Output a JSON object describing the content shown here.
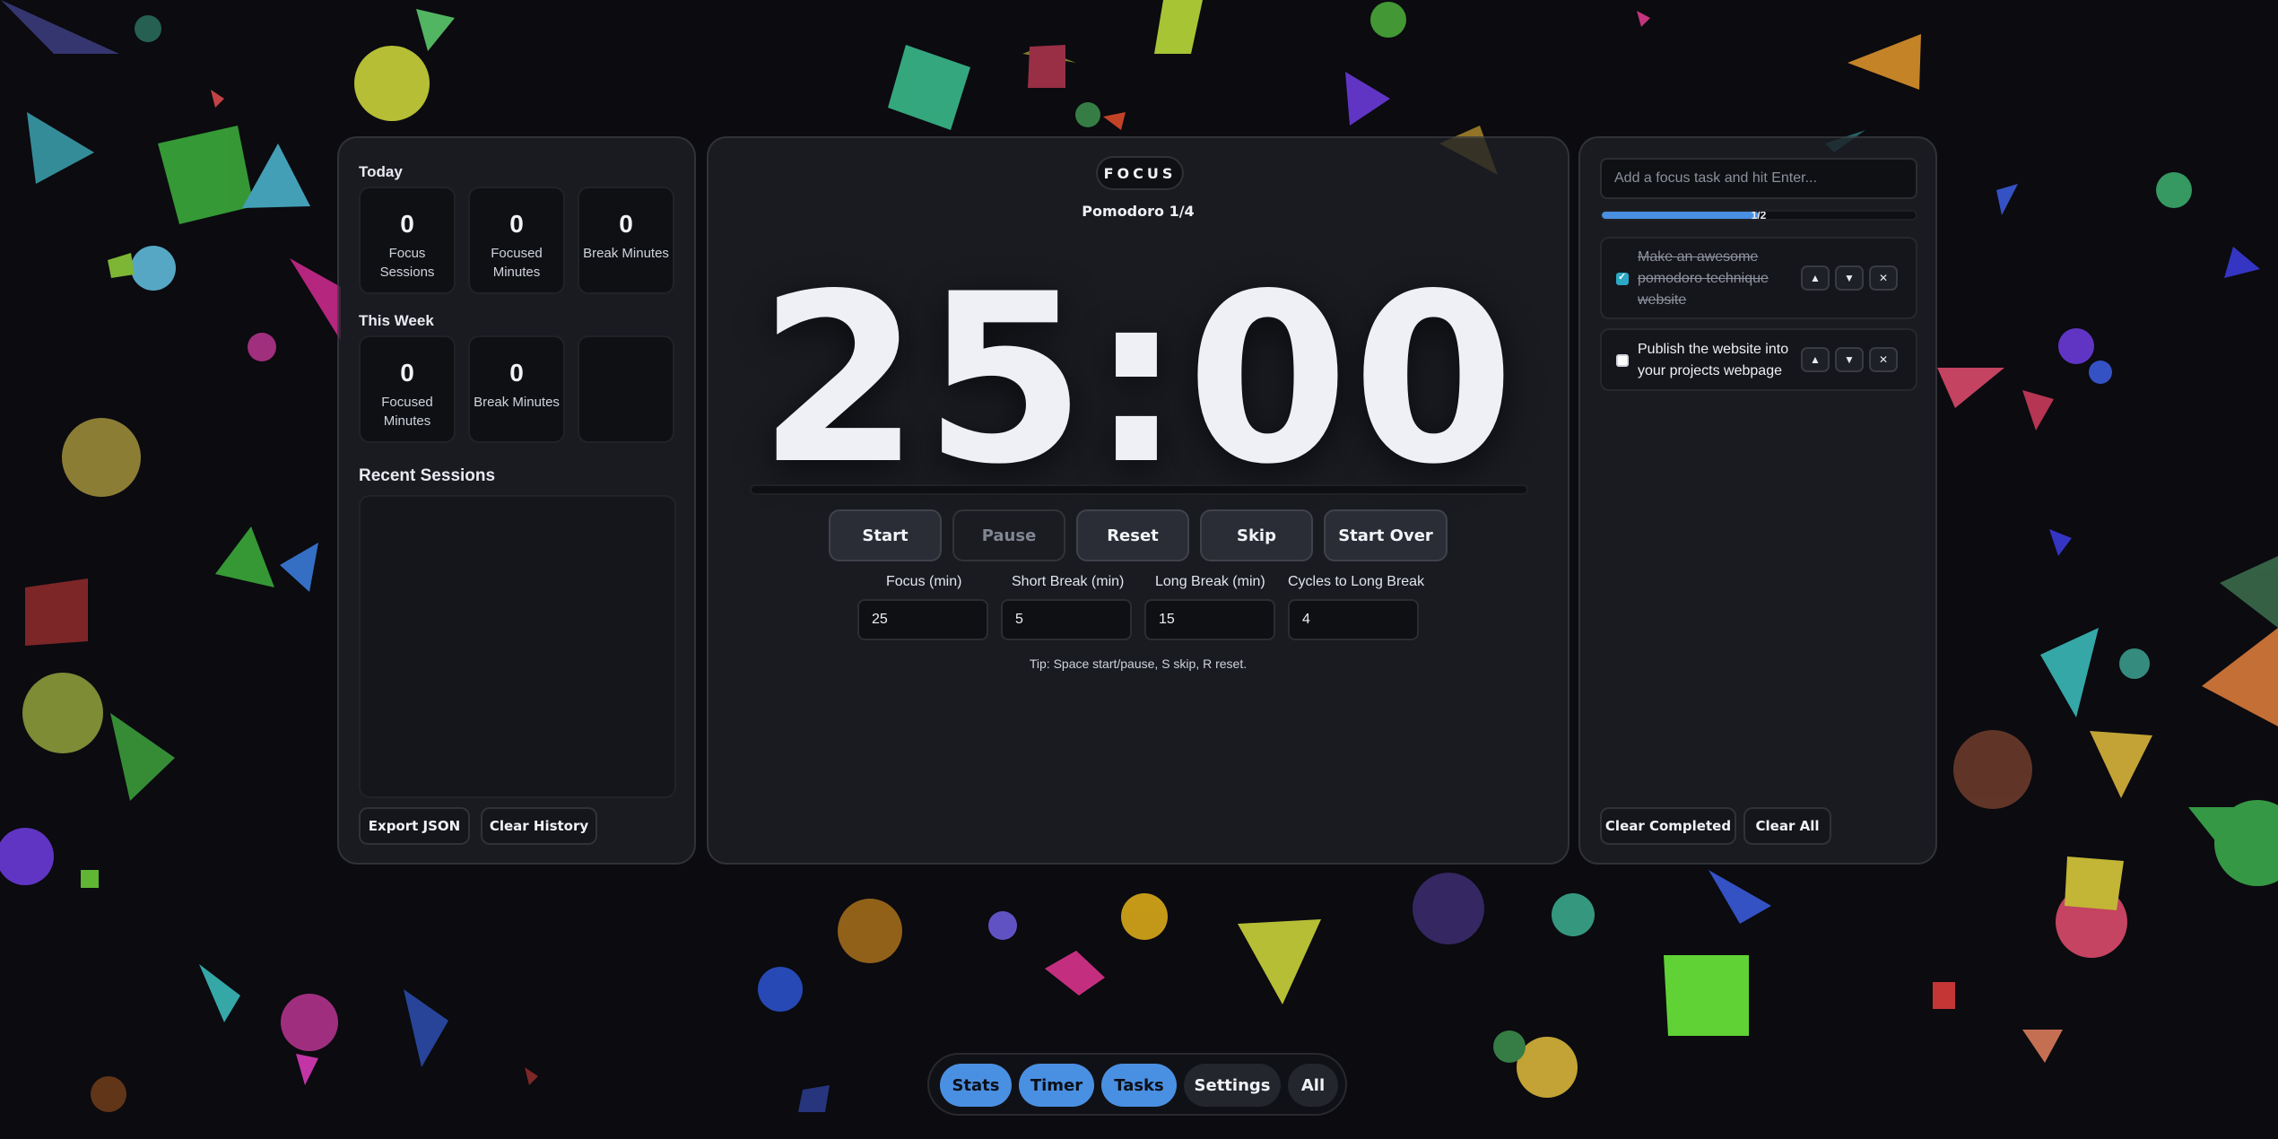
{
  "stats": {
    "today_label": "Today",
    "today": [
      {
        "value": "0",
        "label": "Focus Sessions"
      },
      {
        "value": "0",
        "label": "Focused Minutes"
      },
      {
        "value": "0",
        "label": "Break Minutes"
      }
    ],
    "week_label": "This Week",
    "week": [
      {
        "value": "0",
        "label": "Focused Minutes"
      },
      {
        "value": "0",
        "label": "Break Minutes"
      }
    ],
    "recent_label": "Recent Sessions",
    "export_label": "Export JSON",
    "clear_history_label": "Clear History"
  },
  "timer": {
    "mode": "FOCUS",
    "cycle": "Pomodoro 1/4",
    "time": "25:00",
    "progress": 0,
    "buttons": {
      "start": "Start",
      "pause": "Pause",
      "reset": "Reset",
      "skip": "Skip",
      "start_over": "Start Over"
    },
    "settings": [
      {
        "label": "Focus (min)",
        "value": "25"
      },
      {
        "label": "Short Break (min)",
        "value": "5"
      },
      {
        "label": "Long Break (min)",
        "value": "15"
      },
      {
        "label": "Cycles to Long Break",
        "value": "4"
      }
    ],
    "tip": "Tip: Space start/pause, S skip, R reset."
  },
  "tasks": {
    "input_placeholder": "Add a focus task and hit Enter...",
    "progress_text": "1/2",
    "progress_fraction": 0.5,
    "items": [
      {
        "text": "Make an awesome pomodoro technique website",
        "done": true
      },
      {
        "text": "Publish the website into your projects webpage",
        "done": false
      }
    ],
    "up_icon": "chevron-up-icon",
    "down_icon": "chevron-down-icon",
    "remove_icon": "close-icon",
    "clear_completed_label": "Clear Completed",
    "clear_all_label": "Clear All"
  },
  "nav": [
    {
      "label": "Stats",
      "active": true
    },
    {
      "label": "Timer",
      "active": true
    },
    {
      "label": "Tasks",
      "active": true
    },
    {
      "label": "Settings",
      "active": false
    },
    {
      "label": "All",
      "active": false
    }
  ],
  "colors": {
    "accent": "#4a90e2",
    "check": "#2aa8c4",
    "panel": "#1e2026",
    "background": "#0b0b10"
  }
}
